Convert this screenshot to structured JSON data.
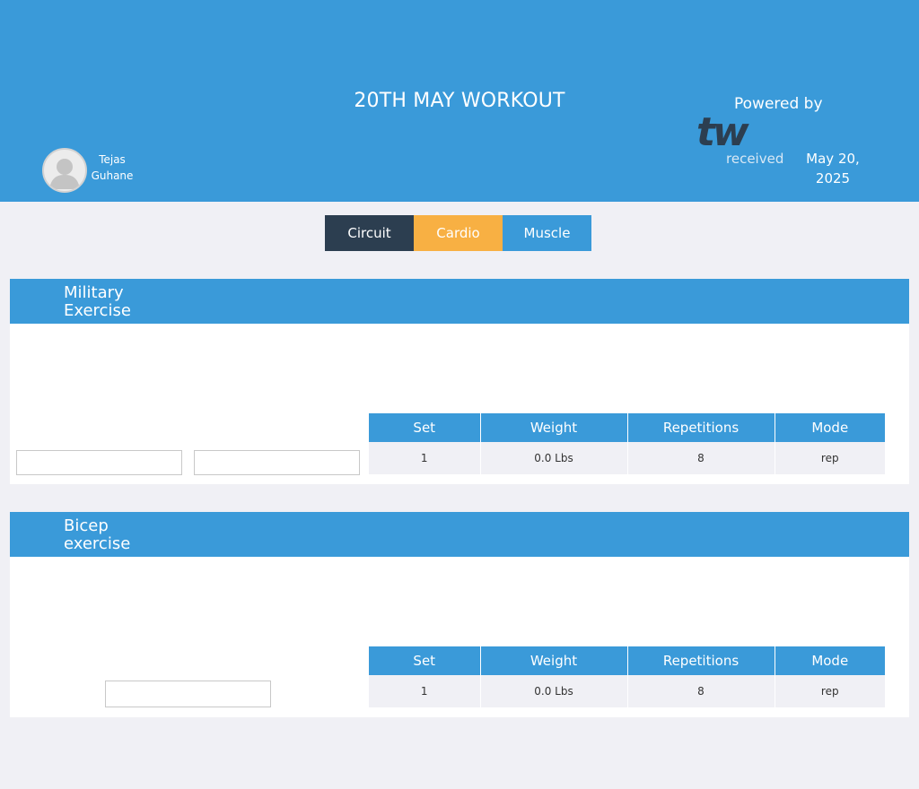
{
  "header": {
    "title": "20TH MAY WORKOUT",
    "user_name": "Tejas Guhane",
    "powered_by": "Powered by",
    "brand_logo": "tw",
    "received_label": "received",
    "date": "May 20, 2025"
  },
  "tabs": [
    {
      "label": "Circuit",
      "color": "#2c3e50"
    },
    {
      "label": "Cardio",
      "color": "#f8b043"
    },
    {
      "label": "Muscle",
      "color": "#3a9ad9"
    }
  ],
  "table_headers": [
    "Set",
    "Weight",
    "Repetitions",
    "Mode"
  ],
  "exercises": [
    {
      "name": "Military Exercise",
      "rows": [
        {
          "set": "1",
          "weight": "0.0 Lbs",
          "reps": "8",
          "mode": "rep"
        }
      ]
    },
    {
      "name": "Bicep exercise",
      "rows": [
        {
          "set": "1",
          "weight": "0.0 Lbs",
          "reps": "8",
          "mode": "rep"
        }
      ]
    }
  ],
  "colors": {
    "accent": "#3a9ad9",
    "dark": "#2c3e50",
    "orange": "#f8b043",
    "page_bg": "#f0f0f5"
  }
}
